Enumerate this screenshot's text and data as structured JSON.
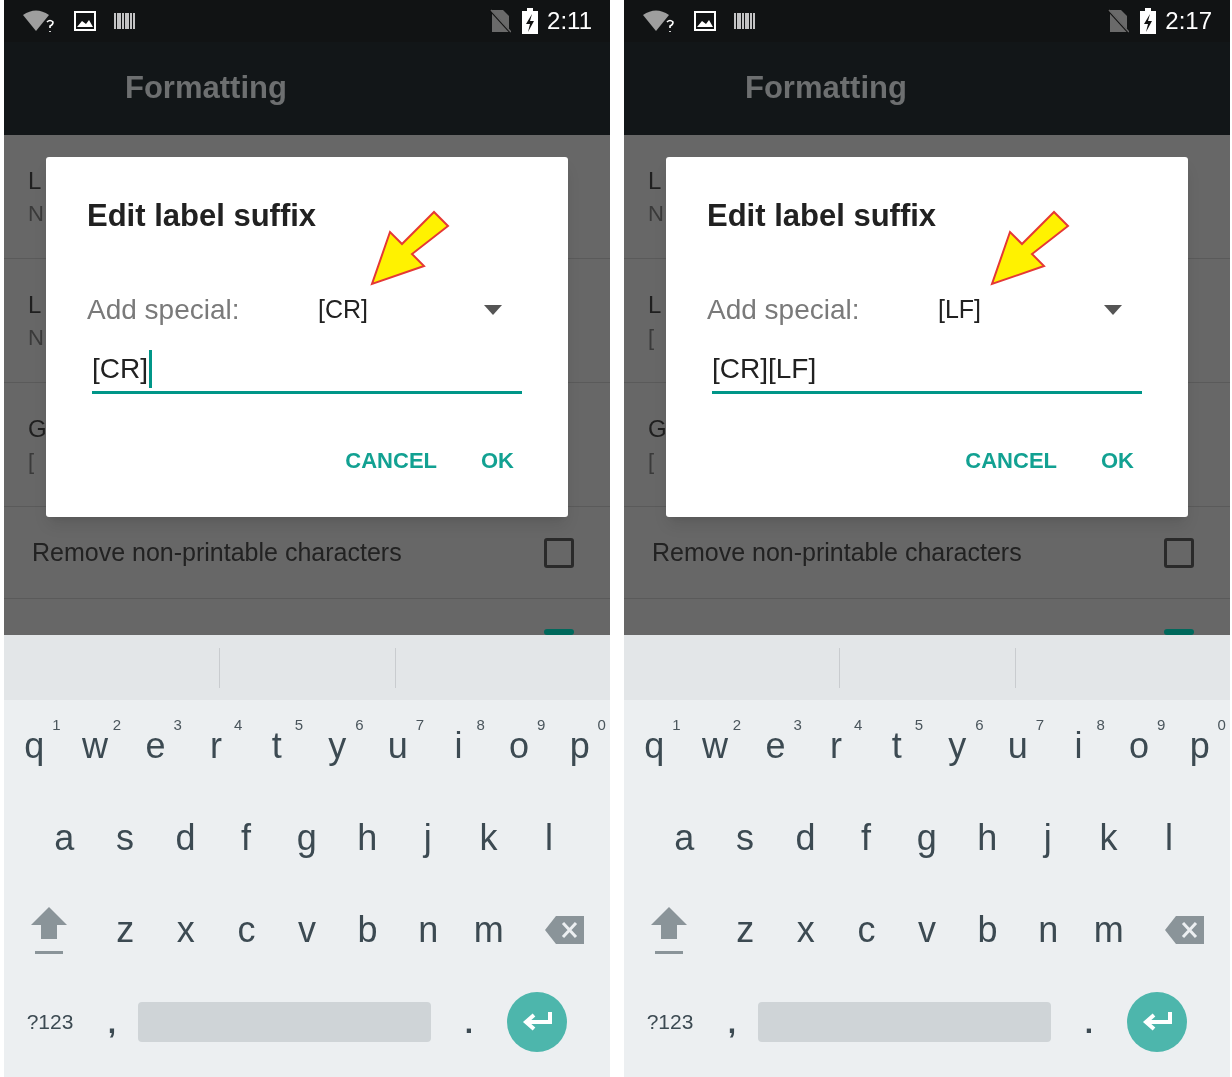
{
  "screens": [
    {
      "status_bar": {
        "time": "2:11"
      },
      "app_bar": {
        "title": "Formatting"
      },
      "list_items": [
        {
          "title": "L",
          "subtitle": "N"
        },
        {
          "title": "L",
          "subtitle": "N"
        },
        {
          "title": "G",
          "subtitle": "["
        }
      ],
      "checkbox_rows": [
        {
          "label": "Remove non-printable characters",
          "checked": false
        },
        {
          "checked": true
        }
      ],
      "dialog": {
        "title": "Edit label suffix",
        "special_label": "Add special:",
        "special_value": "[CR]",
        "input_value": "[CR]",
        "cursor": true,
        "buttons": [
          "CANCEL",
          "OK"
        ]
      },
      "keyboard": {
        "rows": [
          [
            {
              "key": "q",
              "hint": "1"
            },
            {
              "key": "w",
              "hint": "2"
            },
            {
              "key": "e",
              "hint": "3"
            },
            {
              "key": "r",
              "hint": "4"
            },
            {
              "key": "t",
              "hint": "5"
            },
            {
              "key": "y",
              "hint": "6"
            },
            {
              "key": "u",
              "hint": "7"
            },
            {
              "key": "i",
              "hint": "8"
            },
            {
              "key": "o",
              "hint": "9"
            },
            {
              "key": "p",
              "hint": "0"
            }
          ],
          [
            {
              "key": "a"
            },
            {
              "key": "s"
            },
            {
              "key": "d"
            },
            {
              "key": "f"
            },
            {
              "key": "g"
            },
            {
              "key": "h"
            },
            {
              "key": "j"
            },
            {
              "key": "k"
            },
            {
              "key": "l"
            }
          ],
          [
            {
              "key": "z"
            },
            {
              "key": "x"
            },
            {
              "key": "c"
            },
            {
              "key": "v"
            },
            {
              "key": "b"
            },
            {
              "key": "n"
            },
            {
              "key": "m"
            }
          ]
        ],
        "symbols_key": "?123",
        "comma_key": ",",
        "period_key": "."
      }
    },
    {
      "status_bar": {
        "time": "2:17"
      },
      "app_bar": {
        "title": "Formatting"
      },
      "list_items": [
        {
          "title": "L",
          "subtitle": "N"
        },
        {
          "title": "L",
          "subtitle": "["
        },
        {
          "title": "G",
          "subtitle": "["
        }
      ],
      "checkbox_rows": [
        {
          "label": "Remove non-printable characters",
          "checked": false
        },
        {
          "checked": true
        }
      ],
      "dialog": {
        "title": "Edit label suffix",
        "special_label": "Add special:",
        "special_value": "[LF]",
        "input_value": "[CR][LF]",
        "cursor": false,
        "buttons": [
          "CANCEL",
          "OK"
        ]
      },
      "keyboard": {
        "rows": [
          [
            {
              "key": "q",
              "hint": "1"
            },
            {
              "key": "w",
              "hint": "2"
            },
            {
              "key": "e",
              "hint": "3"
            },
            {
              "key": "r",
              "hint": "4"
            },
            {
              "key": "t",
              "hint": "5"
            },
            {
              "key": "y",
              "hint": "6"
            },
            {
              "key": "u",
              "hint": "7"
            },
            {
              "key": "i",
              "hint": "8"
            },
            {
              "key": "o",
              "hint": "9"
            },
            {
              "key": "p",
              "hint": "0"
            }
          ],
          [
            {
              "key": "a"
            },
            {
              "key": "s"
            },
            {
              "key": "d"
            },
            {
              "key": "f"
            },
            {
              "key": "g"
            },
            {
              "key": "h"
            },
            {
              "key": "j"
            },
            {
              "key": "k"
            },
            {
              "key": "l"
            }
          ],
          [
            {
              "key": "z"
            },
            {
              "key": "x"
            },
            {
              "key": "c"
            },
            {
              "key": "v"
            },
            {
              "key": "b"
            },
            {
              "key": "n"
            },
            {
              "key": "m"
            }
          ]
        ],
        "symbols_key": "?123",
        "comma_key": ",",
        "period_key": "."
      }
    }
  ]
}
